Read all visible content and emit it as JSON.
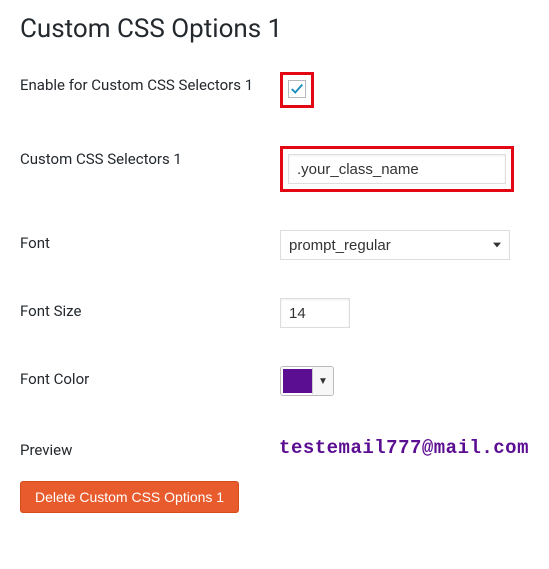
{
  "heading": "Custom CSS Options 1",
  "fields": {
    "enable": {
      "label": "Enable for Custom CSS Selectors 1",
      "checked": true
    },
    "selectors": {
      "label": "Custom CSS Selectors 1",
      "value": ".your_class_name"
    },
    "font": {
      "label": "Font",
      "value": "prompt_regular"
    },
    "fontSize": {
      "label": "Font Size",
      "value": "14"
    },
    "fontColor": {
      "label": "Font Color",
      "color": "#5b0e91"
    },
    "preview": {
      "label": "Preview",
      "text": "testemail777@mail.com"
    }
  },
  "deleteButton": "Delete Custom CSS Options 1"
}
